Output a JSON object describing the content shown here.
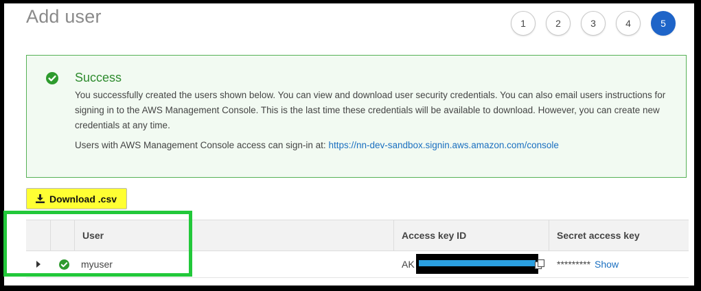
{
  "page": {
    "title": "Add user"
  },
  "steps": [
    "1",
    "2",
    "3",
    "4",
    "5"
  ],
  "active_step": "5",
  "success": {
    "title": "Success",
    "body": "You successfully created the users shown below. You can view and download user security credentials. You can also email users instructions for signing in to the AWS Management Console. This is the last time these credentials will be available to download. However, you can create new credentials at any time.",
    "signin_text": "Users with AWS Management Console access can sign-in at:",
    "signin_url": "https://nn-dev-sandbox.signin.aws.amazon.com/console"
  },
  "toolbar": {
    "download_label": "Download .csv"
  },
  "table": {
    "headers": {
      "user": "User",
      "access_key": "Access key ID",
      "secret_key": "Secret access key"
    },
    "rows": [
      {
        "user": "myuser",
        "access_key_prefix": "AK",
        "secret_masked": "*********",
        "show_label": "Show"
      }
    ]
  },
  "icons": {
    "success": "check-circle-icon",
    "download": "download-icon",
    "expand": "caret-right-icon",
    "copy": "copy-icon"
  },
  "colors": {
    "success_green": "#2e8b2e",
    "step_active": "#1e64c8",
    "link": "#1a6fc0",
    "download_highlight": "#ffff33",
    "annotation_green": "#22c83a",
    "redaction_blue": "#2a9fe0"
  }
}
